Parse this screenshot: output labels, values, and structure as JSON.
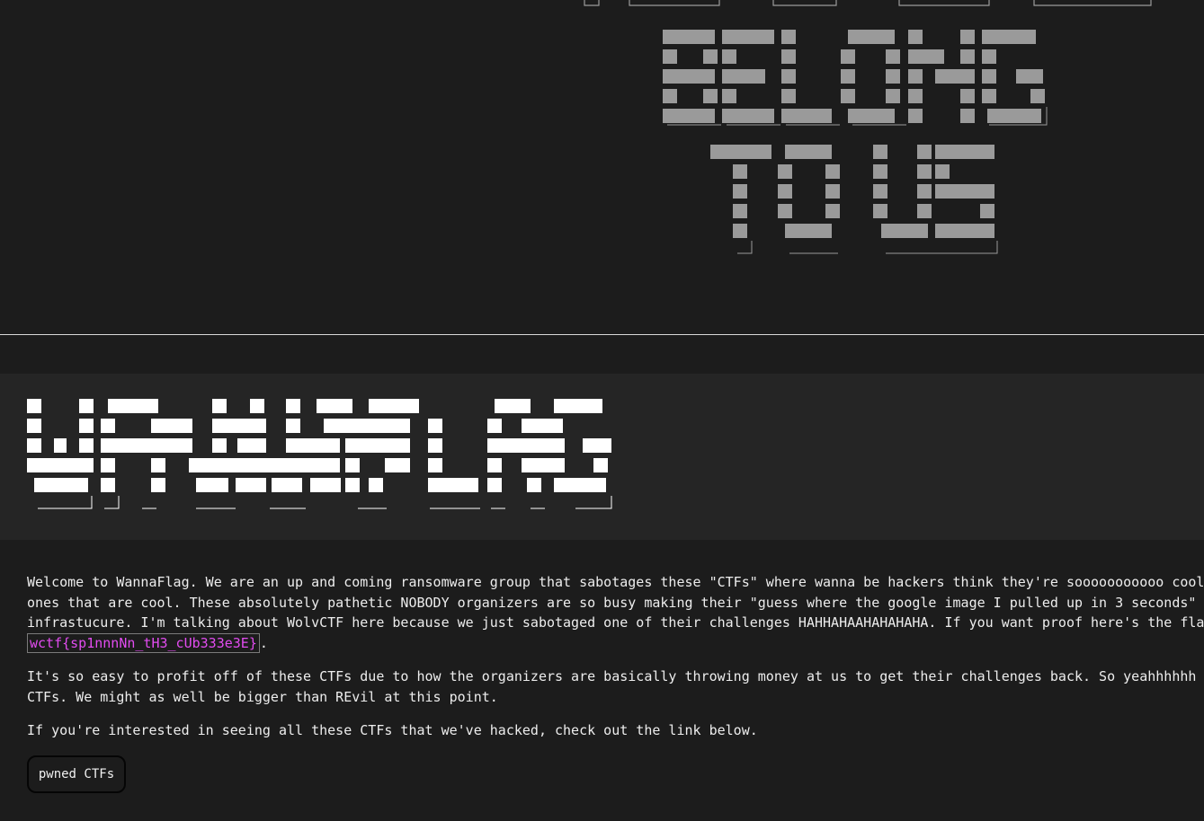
{
  "colors": {
    "background": "#1c1c1c",
    "banner_background": "#252525",
    "flag": "#e24cf0",
    "top_art": "#9a9a9a",
    "logo_art": "#ffffff"
  },
  "top_art": {
    "text": "BELONG TO US"
  },
  "logo": {
    "text": "WANNAFLAG"
  },
  "intro": {
    "line1": "Welcome to WannaFlag. We are an up and coming ransomware group that sabotages these \"CTFs\" where wanna be hackers think they're sooooooooooo cool",
    "line2": "ones that are cool. These absolutely pathetic NOBODY organizers are so busy making their \"guess where the google image I pulled up in 3 seconds\"",
    "line3": "infrastucure. I'm talking about WolvCTF here because we just sabotaged one of their challenges HAHHAHAAHAHAHAHA. If you want proof here's the fla",
    "flag": "wctf{sp1nnnNn_tH3_cUb333e3E}",
    "flag_suffix": "."
  },
  "profit": {
    "line1": "It's so easy to profit off of these CTFs due to how the organizers are basically throwing money at us to get their challenges back. So yeahhhhhh",
    "line2": "CTFs. We might as well be bigger than REvil at this point."
  },
  "cta": {
    "text": "If you're interested in seeing all these CTFs that we've hacked, check out the link below.",
    "button_label": "pwned CTFs"
  }
}
